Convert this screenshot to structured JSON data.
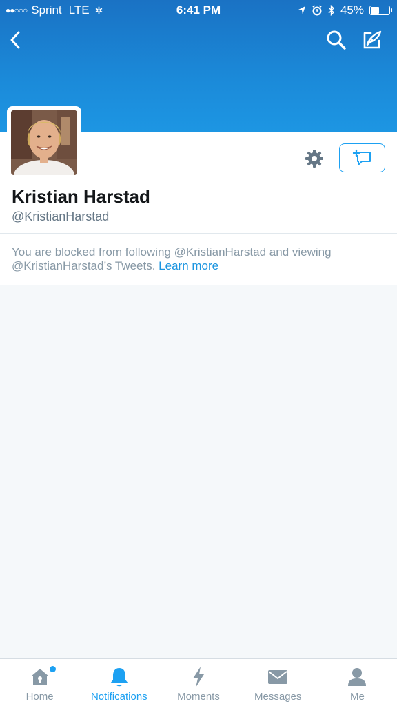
{
  "status_bar": {
    "signal": "●●○○○",
    "carrier": "Sprint",
    "network": "LTE",
    "time": "6:41 PM",
    "battery_percent": "45%",
    "battery_level": 0.45
  },
  "nav": {
    "back_icon": "chevron-left-icon",
    "search_icon": "search-icon",
    "compose_icon": "compose-tweet-icon"
  },
  "profile": {
    "name": "Kristian Harstad",
    "handle": "@KristianHarstad",
    "avatar": "profile-photo"
  },
  "blocked_notice": {
    "text": "You are blocked from following @KristianHarstad and viewing @KristianHarstad’s Tweets.",
    "link": "Learn more"
  },
  "tabs": [
    {
      "label": "Home",
      "icon": "home-icon",
      "active": false,
      "has_dot": true
    },
    {
      "label": "Notifications",
      "icon": "bell-icon",
      "active": true
    },
    {
      "label": "Moments",
      "icon": "lightning-icon",
      "active": false
    },
    {
      "label": "Messages",
      "icon": "envelope-icon",
      "active": false
    },
    {
      "label": "Me",
      "icon": "person-icon",
      "active": false
    }
  ],
  "colors": {
    "brand_blue": "#1da1f2",
    "header_top": "#1a72c4",
    "muted_text": "#8899a6"
  }
}
